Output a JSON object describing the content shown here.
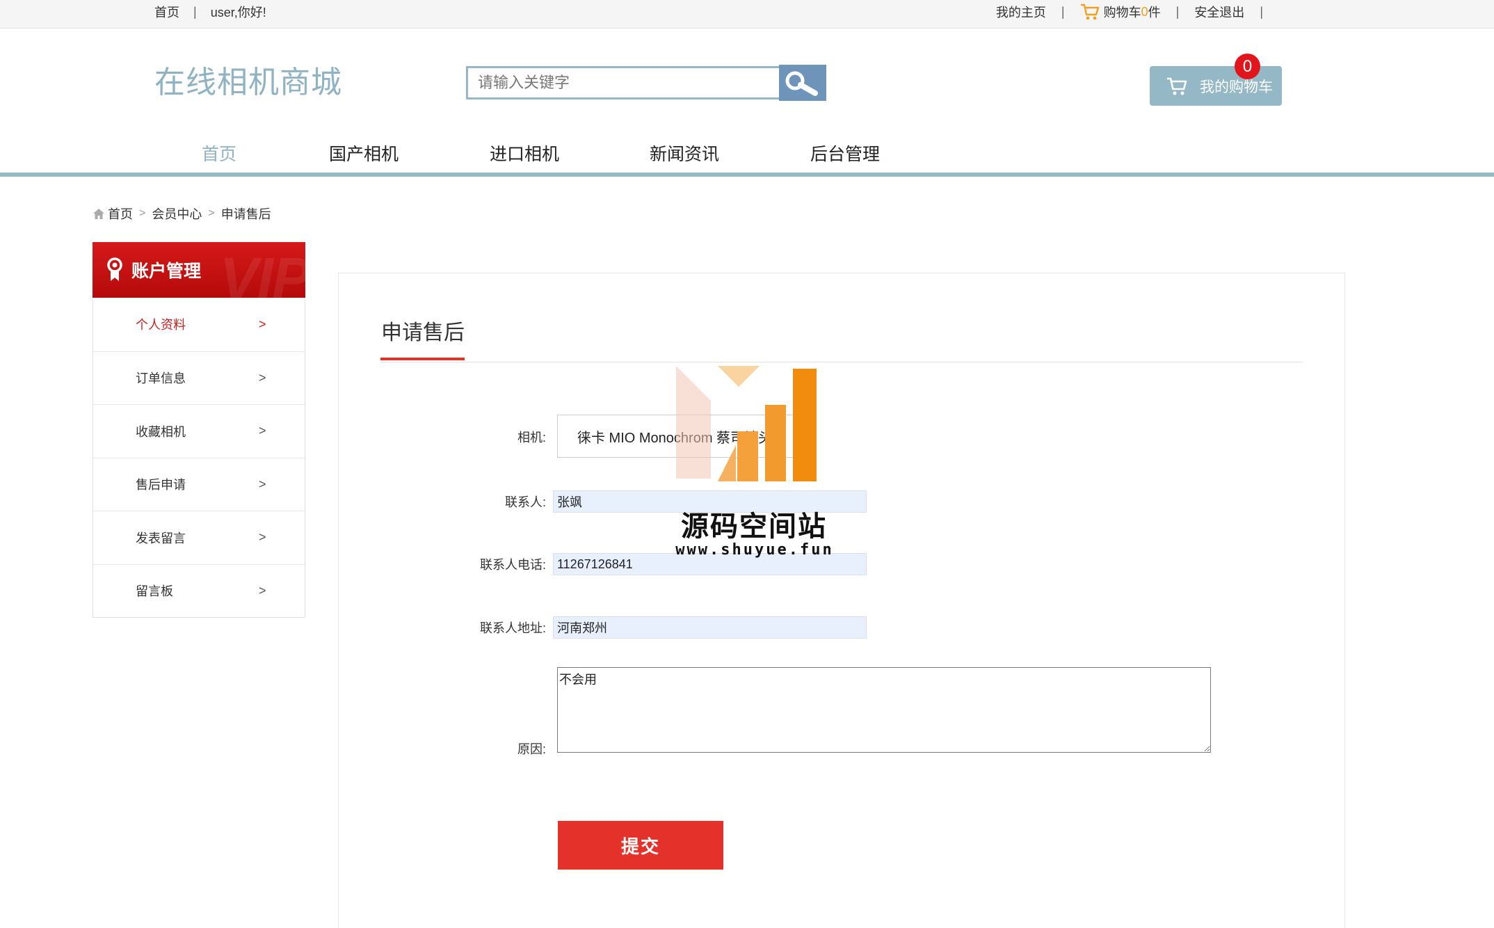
{
  "topbar": {
    "home": "首页",
    "greeting": "user,你好!",
    "my_home": "我的主页",
    "cart_prefix": "购物车",
    "cart_count": "0",
    "cart_suffix": "件",
    "logout": "安全退出"
  },
  "header": {
    "logo": "在线相机商城",
    "search_placeholder": "请输入关键字",
    "my_cart": "我的购物车",
    "cart_badge": "0"
  },
  "nav": {
    "items": [
      "首页",
      "国产相机",
      "进口相机",
      "新闻资讯",
      "后台管理"
    ],
    "active_index": 0
  },
  "breadcrumb": [
    "首页",
    "会员中心",
    "申请售后"
  ],
  "sidebar": {
    "title": "账户管理",
    "watermark": "VIP",
    "items": [
      "个人资料",
      "订单信息",
      "收藏相机",
      "售后申请",
      "发表留言",
      "留言板"
    ],
    "active_index": 0
  },
  "form": {
    "title": "申请售后",
    "camera_label": "相机:",
    "camera_value": "徕卡 MIO Monochrom 蔡司镜头",
    "contact_label": "联系人:",
    "contact_value": "张飒",
    "phone_label": "联系人电话:",
    "phone_value": "11267126841",
    "address_label": "联系人地址:",
    "address_value": "河南郑州",
    "reason_label": "原因:",
    "reason_value": "不会用",
    "submit": "提交"
  },
  "watermark": {
    "name": "源码空间站",
    "url": "www.shuyue.fun"
  },
  "colors": {
    "accent": "#94b8c6",
    "logo": "#8fb3c2",
    "sidebar_head": "#c81414",
    "submit": "#e4312a",
    "badge": "#e2141c"
  }
}
